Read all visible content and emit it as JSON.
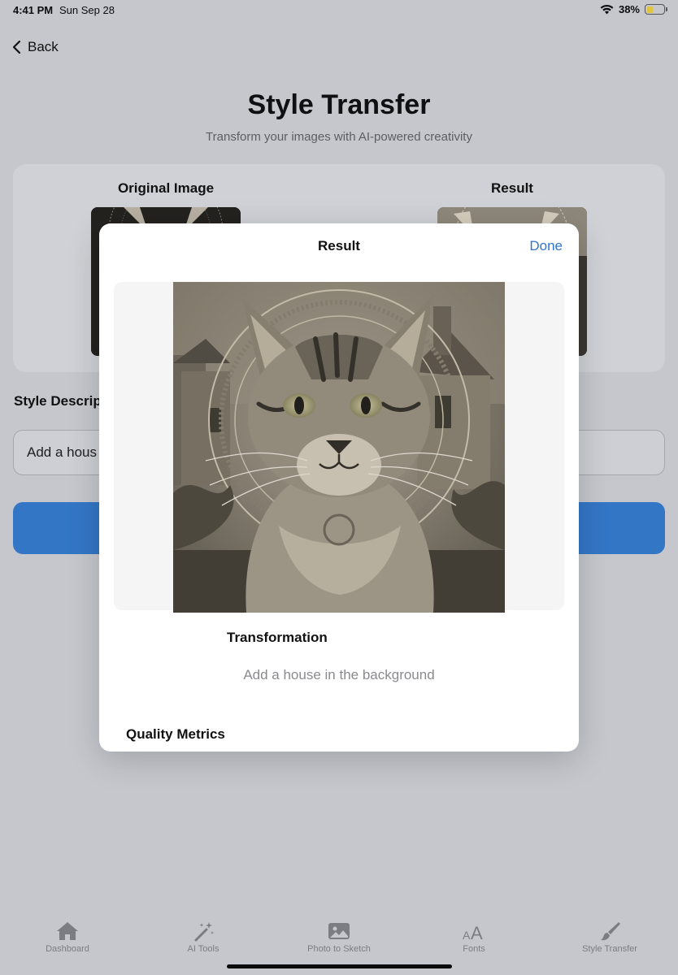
{
  "status_bar": {
    "time": "4:41 PM",
    "date": "Sun Sep 28",
    "battery": "38%",
    "battery_level": 0.38
  },
  "nav": {
    "back_label": "Back"
  },
  "header": {
    "title": "Style Transfer",
    "subtitle": "Transform your images with AI-powered creativity"
  },
  "compare": {
    "original_label": "Original Image",
    "result_label": "Result"
  },
  "style": {
    "label": "Style Descrip",
    "input_value": "Add a hous"
  },
  "modal": {
    "title": "Result",
    "done_label": "Done",
    "transformation_heading": "Transformation",
    "transformation_text": "Add a house in the background",
    "metrics_heading": "Quality Metrics"
  },
  "tabbar": {
    "items": [
      {
        "label": "Dashboard",
        "icon": "house-icon"
      },
      {
        "label": "AI Tools",
        "icon": "magic-wand-icon"
      },
      {
        "label": "Photo to Sketch",
        "icon": "photo-icon"
      },
      {
        "label": "Fonts",
        "icon": "font-size-icon"
      },
      {
        "label": "Style Transfer",
        "icon": "paintbrush-icon"
      }
    ]
  },
  "colors": {
    "accent": "#2f74d0",
    "button": "#3476c6",
    "dimmed_background": "#c5c7cd"
  }
}
